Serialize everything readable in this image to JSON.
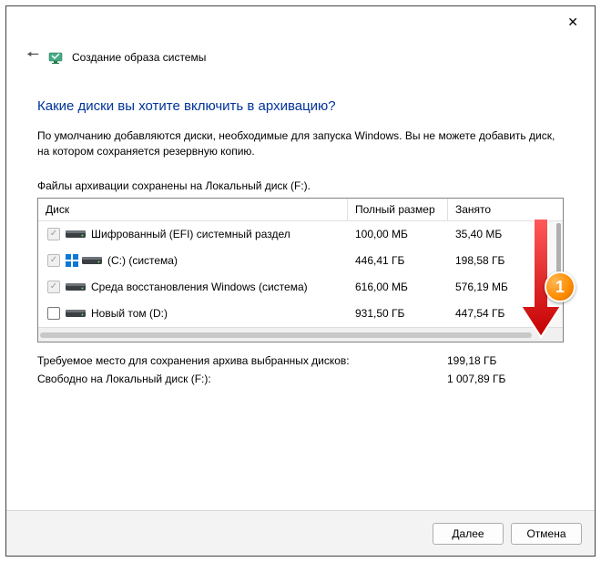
{
  "window": {
    "title": "Создание образа системы"
  },
  "main": {
    "question": "Какие диски вы хотите включить в архивацию?",
    "description": "По умолчанию добавляются диски, необходимые для запуска Windows. Вы не можете добавить диск, на котором сохраняется резервную копию.",
    "saved_to": "Файлы архивации сохранены на Локальный диск (F:)."
  },
  "table": {
    "headers": {
      "disk": "Диск",
      "full": "Полный размер",
      "used": "Занято"
    },
    "rows": [
      {
        "checked": true,
        "enabled": false,
        "win": false,
        "name": "Шифрованный (EFI) системный раздел",
        "full": "100,00 МБ",
        "used": "35,40 МБ"
      },
      {
        "checked": true,
        "enabled": false,
        "win": true,
        "name": "(C:) (система)",
        "full": "446,41 ГБ",
        "used": "198,58 ГБ"
      },
      {
        "checked": true,
        "enabled": false,
        "win": false,
        "name": "Среда восстановления Windows (система)",
        "full": "616,00 МБ",
        "used": "576,19 МБ"
      },
      {
        "checked": false,
        "enabled": true,
        "win": false,
        "name": "Новый том (D:)",
        "full": "931,50 ГБ",
        "used": "447,54 ГБ"
      }
    ]
  },
  "summary": {
    "required_label": "Требуемое место для сохранения архива выбранных дисков:",
    "required_value": "199,18 ГБ",
    "free_label": "Свободно на Локальный диск (F:):",
    "free_value": "1 007,89 ГБ"
  },
  "footer": {
    "next": "Далее",
    "cancel": "Отмена"
  },
  "annotation": {
    "badge": "1"
  }
}
